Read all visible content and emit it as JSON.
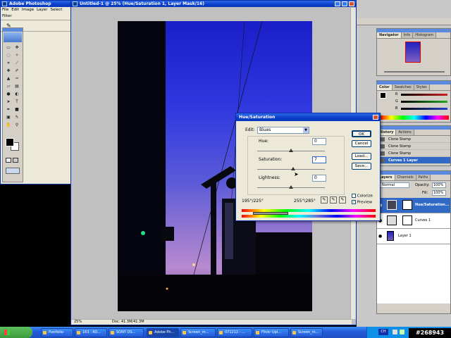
{
  "ps_window": {
    "title": "Adobe Photoshop",
    "menu": [
      "File",
      "Edit",
      "Image",
      "Layer",
      "Select",
      "Filter"
    ]
  },
  "doc_window": {
    "title": "Untitled-1 @ 25% (Hue/Saturation 1, Layer Mask/16)",
    "zoom": "25%",
    "doc_info": "Doc: 41.3M/41.3M"
  },
  "navigator_panel": {
    "tabs": [
      "Navigator",
      "Info",
      "Histogram"
    ]
  },
  "color_panel": {
    "tabs": [
      "Color",
      "Swatches",
      "Styles"
    ],
    "channels": [
      {
        "label": "R",
        "color": "#cc2222"
      },
      {
        "label": "G",
        "color": "#22aa22"
      },
      {
        "label": "B",
        "color": "#2244cc"
      }
    ]
  },
  "history_panel": {
    "tabs": [
      "History",
      "Actions"
    ],
    "items": [
      "Clone Stamp",
      "Clone Stamp",
      "Clone Stamp",
      "Curves 1 Layer"
    ],
    "selected_index": 3
  },
  "layers_panel": {
    "tabs": [
      "Layers",
      "Channels",
      "Paths"
    ],
    "blend_mode": "Normal",
    "opacity_label": "Opacity:",
    "opacity_value": "100%",
    "fill_label": "Fill:",
    "fill_value": "100%",
    "layers": [
      {
        "name": "Hue/Saturation...",
        "selected": true
      },
      {
        "name": "Curves 1",
        "selected": false
      },
      {
        "name": "Layer 1",
        "selected": false
      }
    ]
  },
  "dialog": {
    "title": "Hue/Saturation",
    "edit_label": "Edit:",
    "edit_value": "Blues",
    "hue_label": "Hue:",
    "hue_value": "0",
    "hue_pos": 0.5,
    "saturation_label": "Saturation:",
    "saturation_value": "7",
    "saturation_pos": 0.535,
    "lightness_label": "Lightness:",
    "lightness_value": "0",
    "lightness_pos": 0.5,
    "range_left": "195°/225°",
    "range_right": "255°\\285°",
    "buttons": {
      "ok": "OK",
      "cancel": "Cancel",
      "load": "Load...",
      "save": "Save..."
    },
    "colorize_label": "Colorize",
    "colorize_checked": false,
    "preview_label": "Preview",
    "preview_checked": true
  },
  "taskbar": {
    "tasks": [
      "Postfolio",
      "163 : KO...",
      "SONY DS...",
      "Adobe Ph...",
      "Screen_m...",
      "071212 - ...",
      "Flickr Upl...",
      "Screen_m..."
    ],
    "tray_lang": "CH",
    "watermark": "#268943"
  },
  "colors": {
    "xp_blue": "#0a3cc8",
    "taskbar_blue": "#245edb",
    "start_green": "#3c9a3c",
    "canvas_grey": "#c0c0c0",
    "selected_row": "#3169c6"
  }
}
